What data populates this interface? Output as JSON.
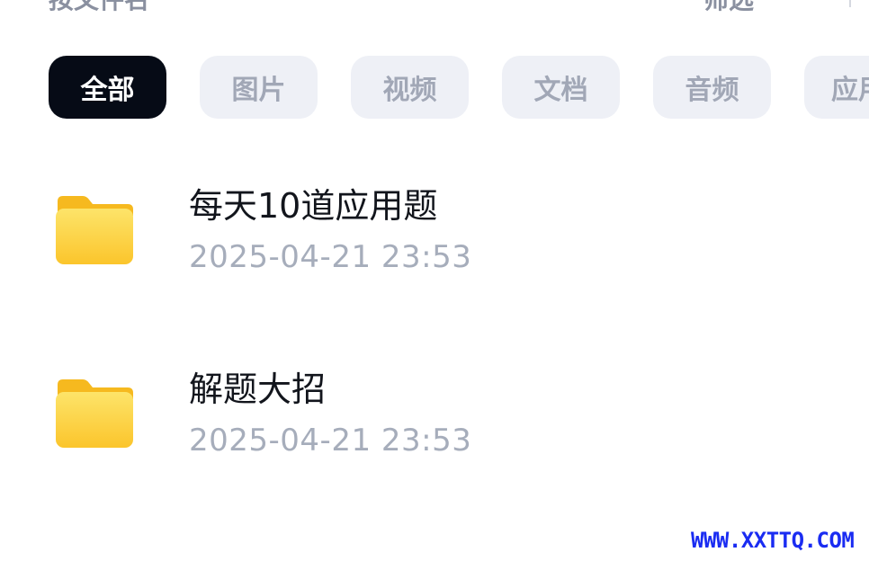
{
  "topbar": {
    "sort_label": "按文件名",
    "filter_label": "筛选"
  },
  "tabs": [
    {
      "label": "全部",
      "active": true
    },
    {
      "label": "图片",
      "active": false
    },
    {
      "label": "视频",
      "active": false
    },
    {
      "label": "文档",
      "active": false
    },
    {
      "label": "音频",
      "active": false
    },
    {
      "label": "应用",
      "active": false
    }
  ],
  "files": [
    {
      "name": "每天10道应用题",
      "date": "2025-04-21  23:53",
      "icon": "folder-icon"
    },
    {
      "name": "解题大招",
      "date": "2025-04-21  23:53",
      "icon": "folder-icon"
    }
  ],
  "watermark": "WWW.XXTTQ.COM",
  "colors": {
    "active_tab_bg": "#060b16",
    "tab_bg": "#eef0f6",
    "folder": "#fbc935",
    "watermark": "#1a2cf2"
  }
}
